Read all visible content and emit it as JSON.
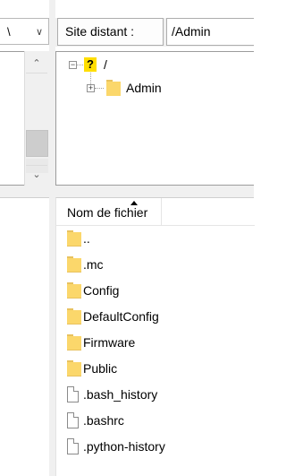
{
  "local": {
    "combo_text": "\\",
    "combo_dropdown_icon": "chevron-down-icon",
    "scroll_up_glyph": "⌃",
    "scroll_down_glyph": "⌄"
  },
  "remote": {
    "site_label": "Site distant :",
    "path_value": "/Admin",
    "tree": {
      "root_label": "/",
      "child_label": "Admin"
    },
    "list": {
      "column_name": "Nom de fichier",
      "rows": [
        {
          "name": "..",
          "type": "folder"
        },
        {
          "name": ".mc",
          "type": "folder"
        },
        {
          "name": "Config",
          "type": "folder"
        },
        {
          "name": "DefaultConfig",
          "type": "folder"
        },
        {
          "name": "Firmware",
          "type": "folder"
        },
        {
          "name": "Public",
          "type": "folder"
        },
        {
          "name": ".bash_history",
          "type": "file"
        },
        {
          "name": ".bashrc",
          "type": "file"
        },
        {
          "name": ".python-history",
          "type": "file"
        }
      ]
    }
  },
  "colors": {
    "folder": "#fbd76b",
    "folder_tab": "#e8c25f",
    "unknown_badge": "#ffde00",
    "panel_bg": "#f0f0f0"
  }
}
